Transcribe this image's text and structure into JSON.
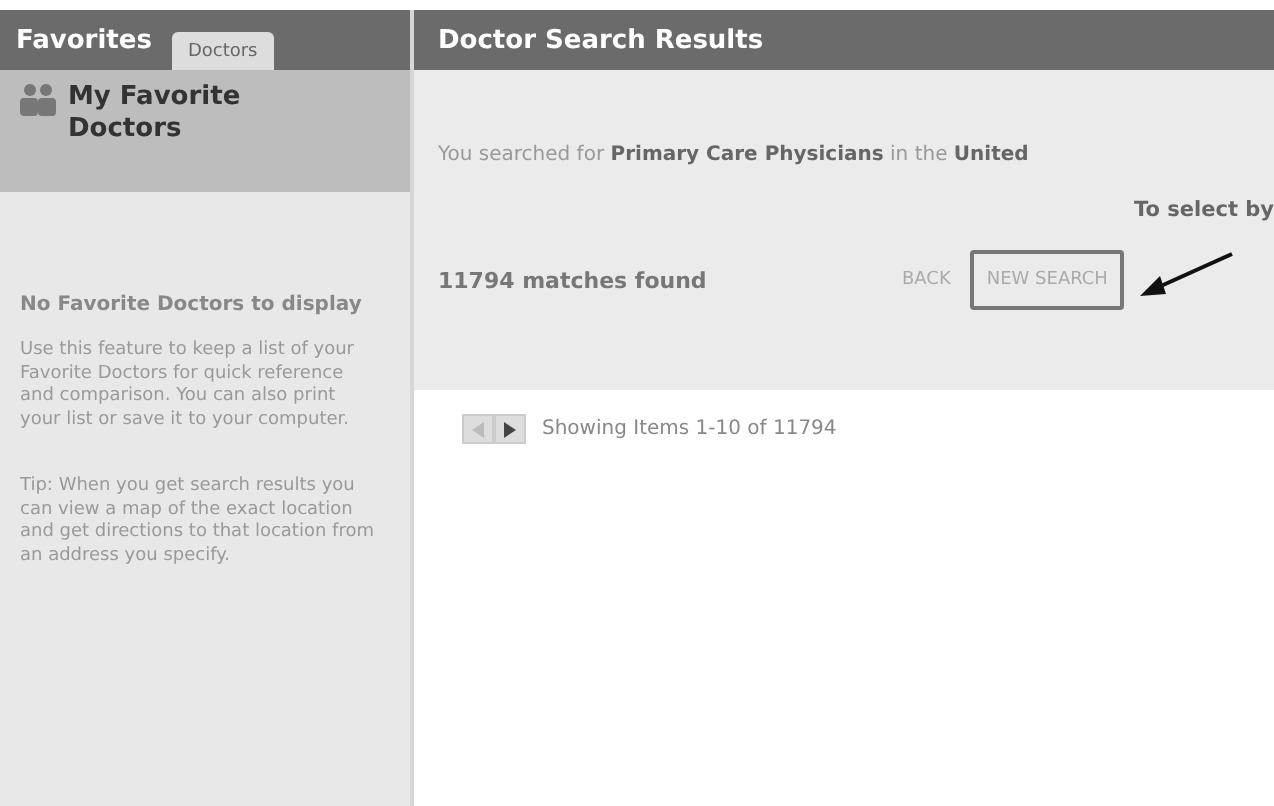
{
  "sidebar": {
    "title": "Favorites",
    "tabs": [
      {
        "label": "Doctors",
        "selected": true
      }
    ],
    "heading": "My Favorite Doctors",
    "empty_message": "No Favorite Doctors to display",
    "paragraphs": [
      "Use this feature to keep a list of your Favorite Doctors for quick reference and comparison. You can also print your list or save it to your computer.",
      "Tip: When you get search results you can view a map of the exact location and get directions to that location from an address you specify."
    ]
  },
  "main": {
    "title": "Doctor Search Results",
    "summary": "You searched for **Primary Care Physicians** in the **United**",
    "select_hint": "To select by",
    "matches": "11794 matches found",
    "actions": [
      {
        "label": "BACK",
        "highlighted": false
      },
      {
        "label": "NEW SEARCH",
        "highlighted": true
      }
    ],
    "pager": {
      "prev_disabled": true,
      "next_disabled": false,
      "text": "Showing Items 1-10 of 11794"
    }
  }
}
